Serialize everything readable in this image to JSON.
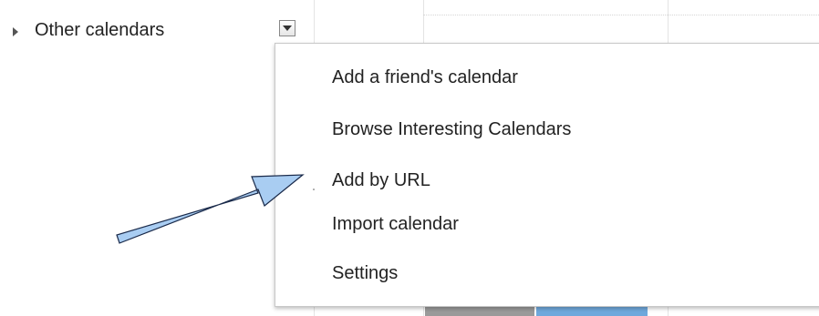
{
  "sidebar": {
    "section_label": "Other calendars",
    "expand_icon": "triangle-right-icon",
    "toggle_icon": "chevron-down-icon"
  },
  "dropdown": {
    "items": [
      {
        "label": "Add a friend's calendar"
      },
      {
        "label": "Browse Interesting Calendars"
      },
      {
        "label": "Add by URL"
      },
      {
        "label": "Import calendar"
      },
      {
        "label": "Settings"
      }
    ]
  },
  "annotation": {
    "arrow_fill": "#a9cdf2",
    "arrow_stroke": "#1a2a4a",
    "points_to": "Add by URL"
  },
  "colors": {
    "grid_bottom_gray": "#9a9a9a",
    "grid_bottom_blue": "#6fa8dc"
  }
}
